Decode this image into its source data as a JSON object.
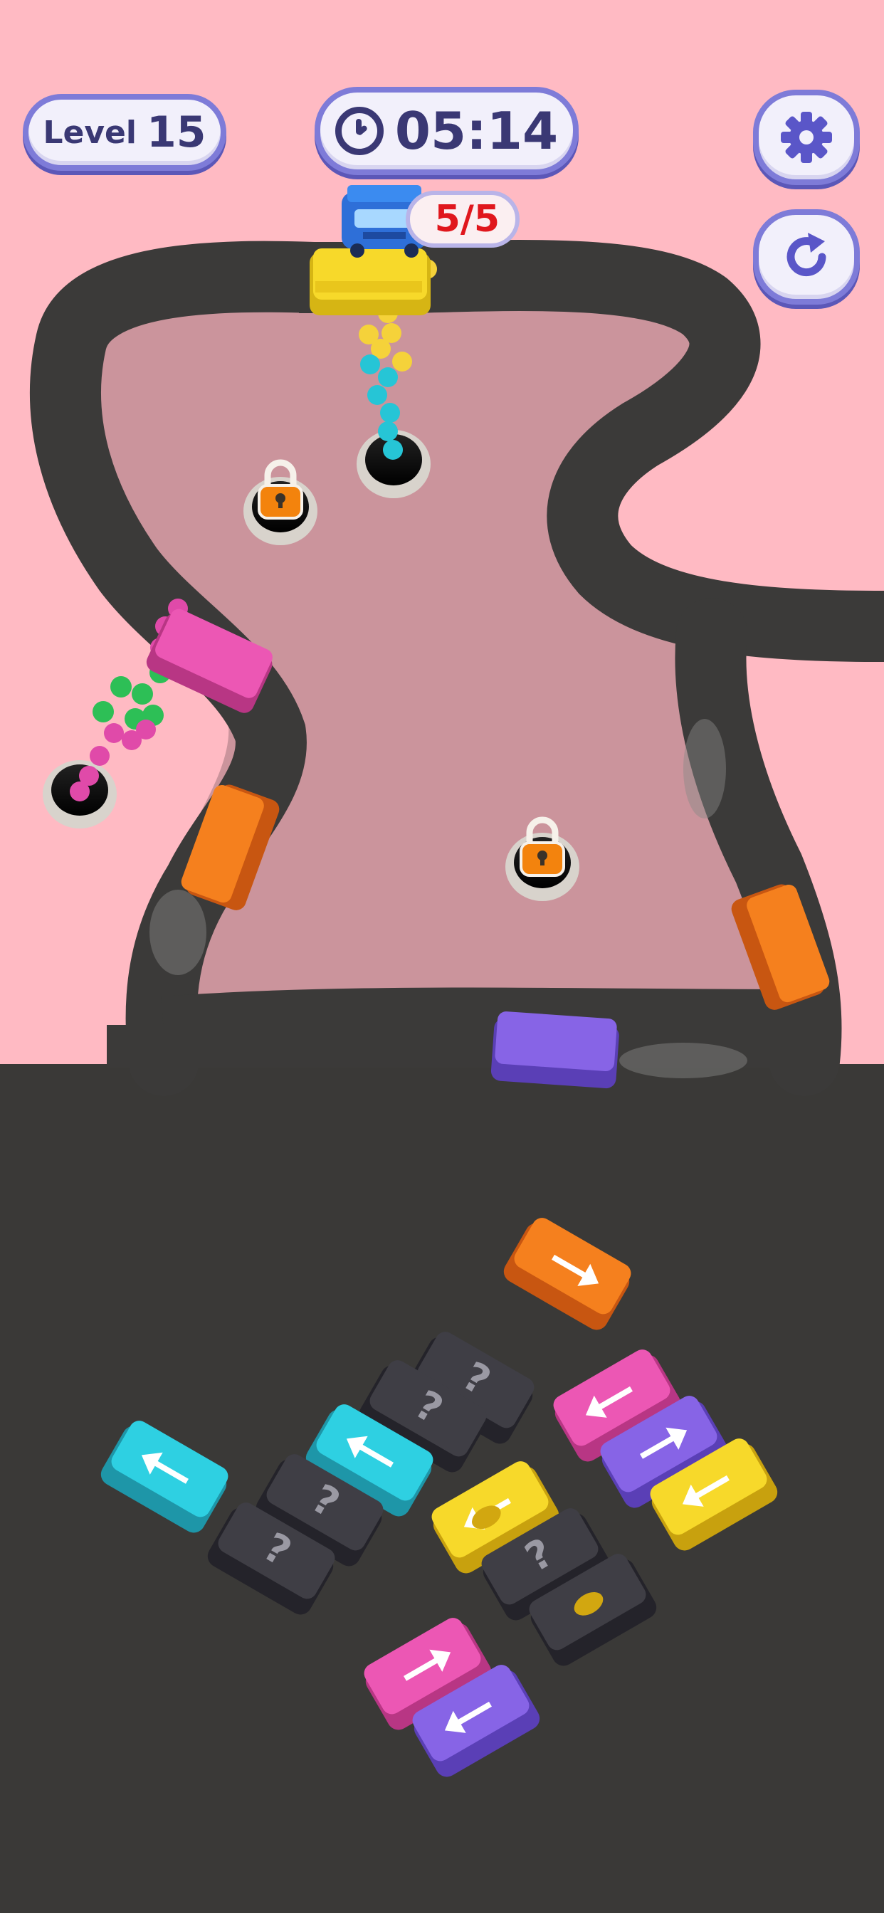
{
  "hud": {
    "level_label": "Level",
    "level_number": "15",
    "timer": "05:14",
    "bus_counter": "5/5"
  },
  "icons": {
    "settings": "gear-icon",
    "restart": "restart-icon",
    "timer": "clock-icon",
    "lock": "padlock-icon",
    "mystery": "question-mark-icon"
  },
  "colors": {
    "background_pink": "#ffbac3",
    "road": "#3b3a39",
    "parking_lot": "#3a3937",
    "hud_border": "#7e7bd8",
    "counter_text": "#e0171d"
  }
}
